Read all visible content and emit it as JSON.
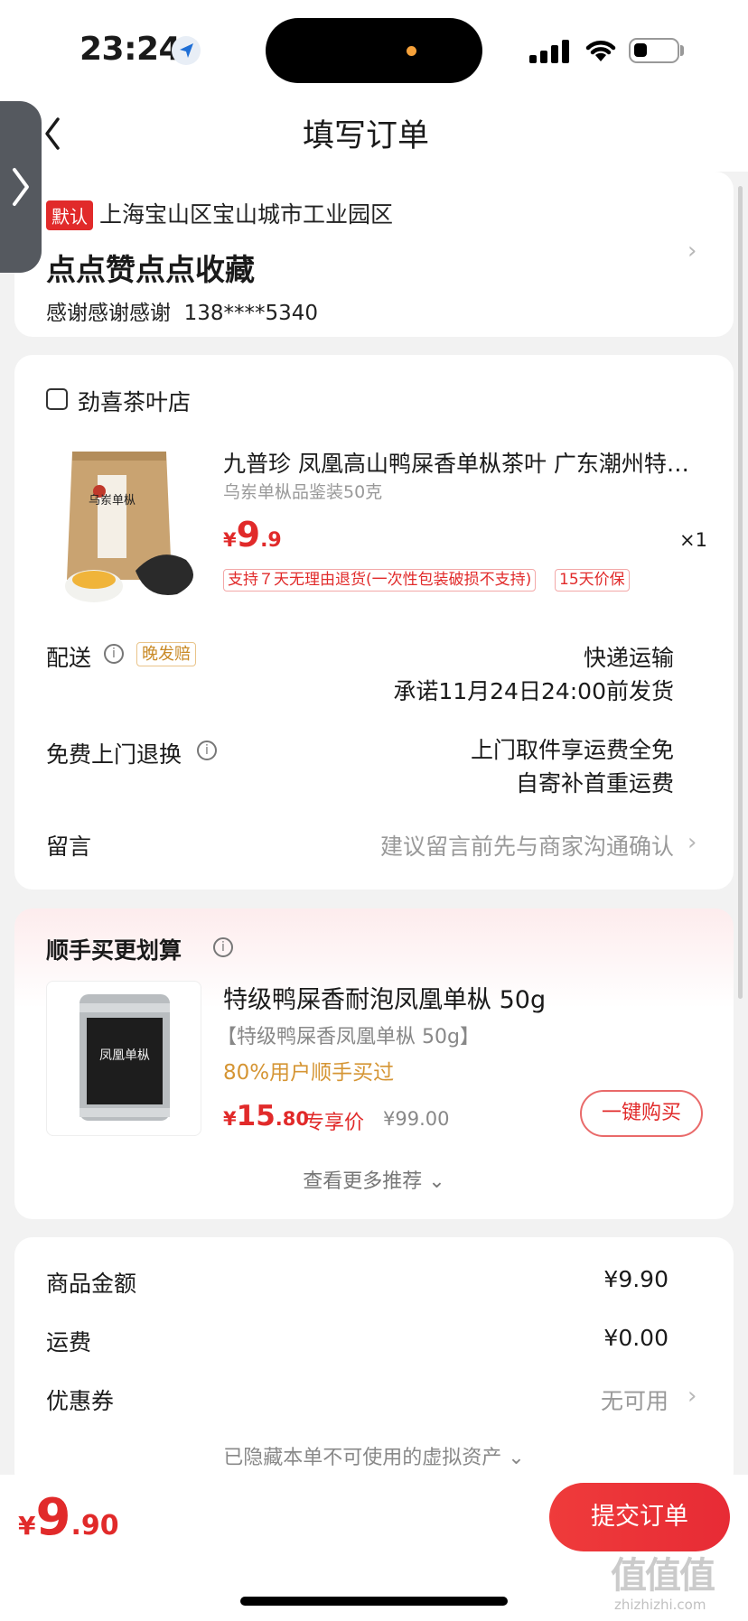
{
  "status_bar": {
    "time": "23:24"
  },
  "nav": {
    "title": "填写订单",
    "back_icon": "chevron-left-icon"
  },
  "address": {
    "default_tag": "默认",
    "line": "上海宝山区宝山城市工业园区",
    "name": "点点赞点点收藏",
    "contact_name": "感谢感谢感谢",
    "phone": "138****5340"
  },
  "shop": {
    "name": "劲喜茶叶店",
    "product": {
      "title": "九普珍 凤凰高山鸭屎香单枞茶叶 广东潮州特…",
      "sku": "乌岽单枞品鉴装50克",
      "price_symbol": "¥",
      "price_int": "9",
      "price_dec": ".9",
      "qty": "×1",
      "tags": [
        "支持７天无理由退货(一次性包装破损不支持)",
        "15天价保"
      ],
      "package_label": "乌岽单枞"
    },
    "delivery": {
      "label": "配送",
      "late_tag": "晚发赔",
      "method": "快递运输",
      "promise": "承诺11月24日24:00前发货"
    },
    "return": {
      "label": "免费上门退换",
      "line1": "上门取件享运费全免",
      "line2": "自寄补首重运费"
    },
    "message": {
      "label": "留言",
      "placeholder": "建议留言前先与商家沟通确认"
    }
  },
  "recommend": {
    "title": "顺手买更划算",
    "item": {
      "name": "特级鸭屎香耐泡凤凰单枞 50g",
      "sub": "【特级鸭屎香凤凰单枞 50g】",
      "hint": "80%用户顺手买过",
      "price_symbol": "¥",
      "price_int": "15",
      "price_dec": ".80",
      "price_label": "专享价",
      "old_price": "¥99.00",
      "buy_label": "一键购买",
      "can_label": "凤凰单枞"
    },
    "more_label": "查看更多推荐"
  },
  "summary": {
    "rows": [
      {
        "label": "商品金额",
        "value": "¥9.90"
      },
      {
        "label": "运费",
        "value": "¥0.00"
      },
      {
        "label": "优惠券",
        "value": "无可用"
      }
    ],
    "hidden_note": "已隐藏本单不可使用的虚拟资产"
  },
  "bottom": {
    "total_symbol": "¥",
    "total_int": "9",
    "total_dec": ".90",
    "submit_label": "提交订单"
  },
  "watermark": {
    "main": "值值值",
    "sub": "zhizhizhi.com"
  },
  "colors": {
    "accent": "#e12a2a",
    "hint": "#d59534",
    "background": "#f2f2f2"
  }
}
